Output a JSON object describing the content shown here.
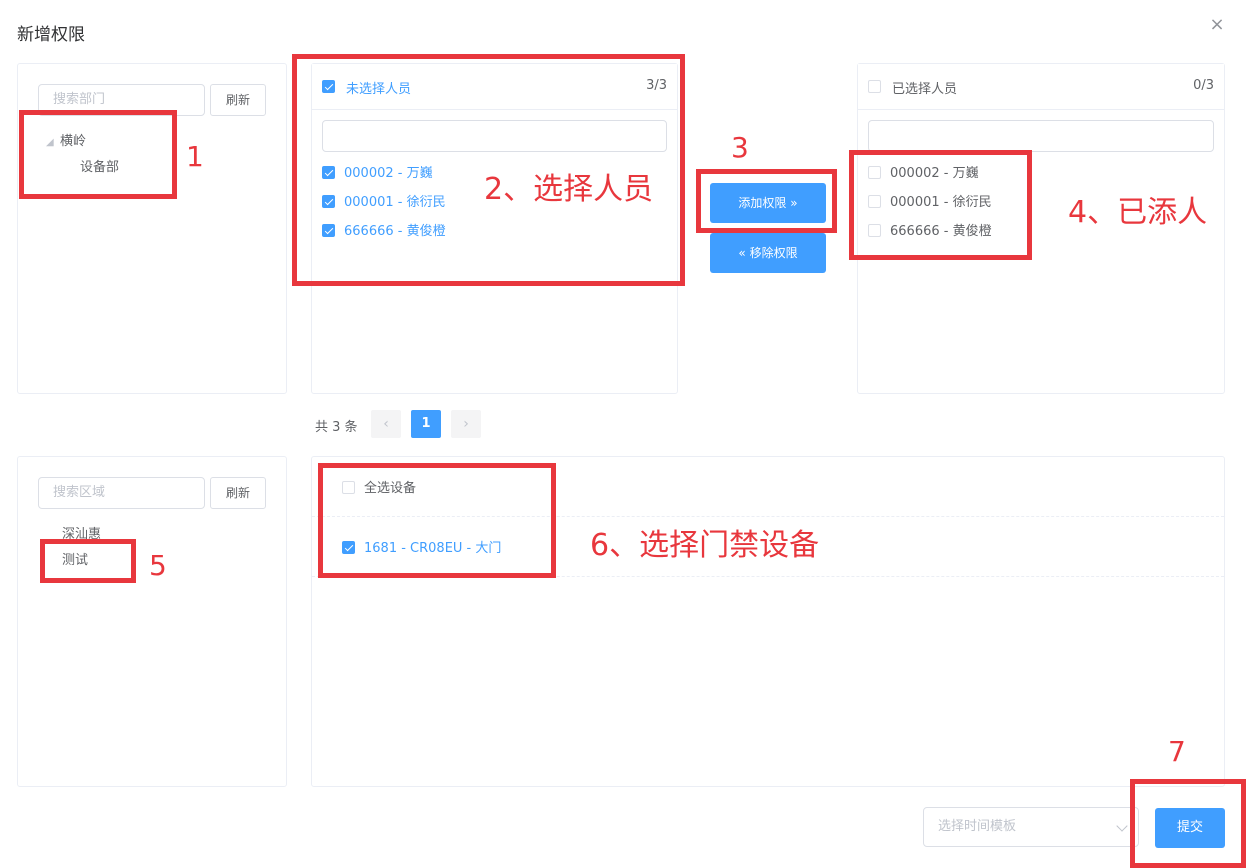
{
  "dialog": {
    "title": "新增权限",
    "close_glyph": "×"
  },
  "dept": {
    "search_placeholder": "搜索部门",
    "refresh_label": "刷新",
    "tree": [
      {
        "label": "横岭",
        "caret": "◢"
      },
      {
        "label": "设备部"
      }
    ]
  },
  "unselected": {
    "title": "未选择人员",
    "count": "3/3",
    "items": [
      "000002 - 万巍",
      "000001 - 徐衍民",
      "666666 - 黄俊橙"
    ]
  },
  "transfer": {
    "add_label": "添加权限 »",
    "remove_label": "« 移除权限"
  },
  "selected": {
    "title": "已选择人员",
    "count": "0/3",
    "items": [
      "000002 - 万巍",
      "000001 - 徐衍民",
      "666666 - 黄俊橙"
    ]
  },
  "pagination": {
    "total": "共 3 条",
    "prev": "‹",
    "page": "1",
    "next": "›"
  },
  "area": {
    "search_placeholder": "搜索区域",
    "refresh_label": "刷新",
    "items": [
      "深汕惠",
      "测试"
    ]
  },
  "devices": {
    "select_all_label": "全选设备",
    "items": [
      "1681 - CR08EU - 大门"
    ]
  },
  "footer": {
    "time_template_placeholder": "选择时间模板",
    "submit_label": "提交"
  },
  "annotations": {
    "n1": "1",
    "n2": "2、选择人员",
    "n3": "3",
    "n4": "4、已添人",
    "n5": "5",
    "n6": "6、选择门禁设备",
    "n7": "7"
  },
  "colors": {
    "primary": "#409eff",
    "annotation": "#e8373d"
  }
}
